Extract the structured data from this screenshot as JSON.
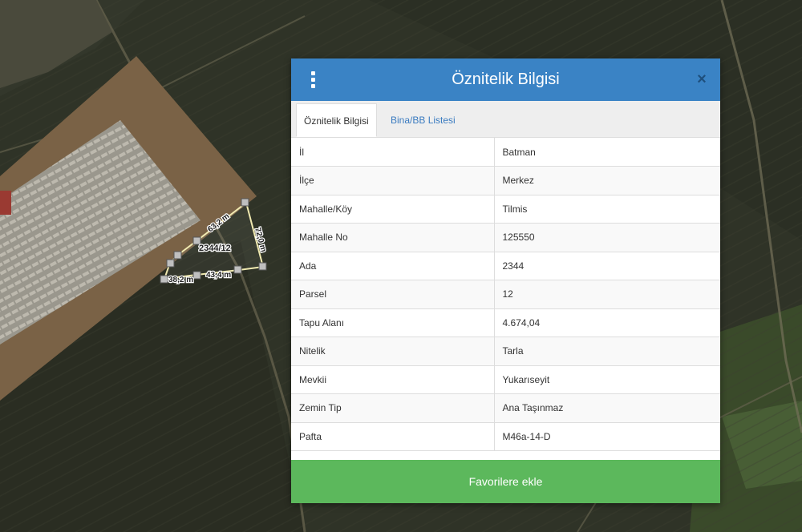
{
  "map": {
    "parcel_label": "2344/12",
    "edge_labels": [
      "63,2 m",
      "72,0 m",
      "43,4 m",
      "38,2 m"
    ]
  },
  "dialog": {
    "menu_icon": "vertical-dots-icon",
    "title": "Öznitelik Bilgisi",
    "close_icon": "close-icon",
    "close_glyph": "×",
    "tabs": [
      {
        "label": "Öznitelik Bilgisi",
        "active": true
      },
      {
        "label": "Bina/BB Listesi",
        "active": false
      }
    ],
    "rows": [
      {
        "key": "İl",
        "value": "Batman"
      },
      {
        "key": "İlçe",
        "value": "Merkez"
      },
      {
        "key": "Mahalle/Köy",
        "value": "Tilmis"
      },
      {
        "key": "Mahalle No",
        "value": "125550"
      },
      {
        "key": "Ada",
        "value": "2344"
      },
      {
        "key": "Parsel",
        "value": "12"
      },
      {
        "key": "Tapu Alanı",
        "value": "4.674,04"
      },
      {
        "key": "Nitelik",
        "value": "Tarla"
      },
      {
        "key": "Mevkii",
        "value": "Yukarıseyit"
      },
      {
        "key": "Zemin Tip",
        "value": "Ana Taşınmaz"
      },
      {
        "key": "Pafta",
        "value": "M46a-14-D"
      }
    ],
    "favorite_button": "Favorilere ekle"
  },
  "colors": {
    "header": "#3a83c5",
    "favorite": "#5cb85c",
    "tab_link": "#3a7bc0"
  }
}
